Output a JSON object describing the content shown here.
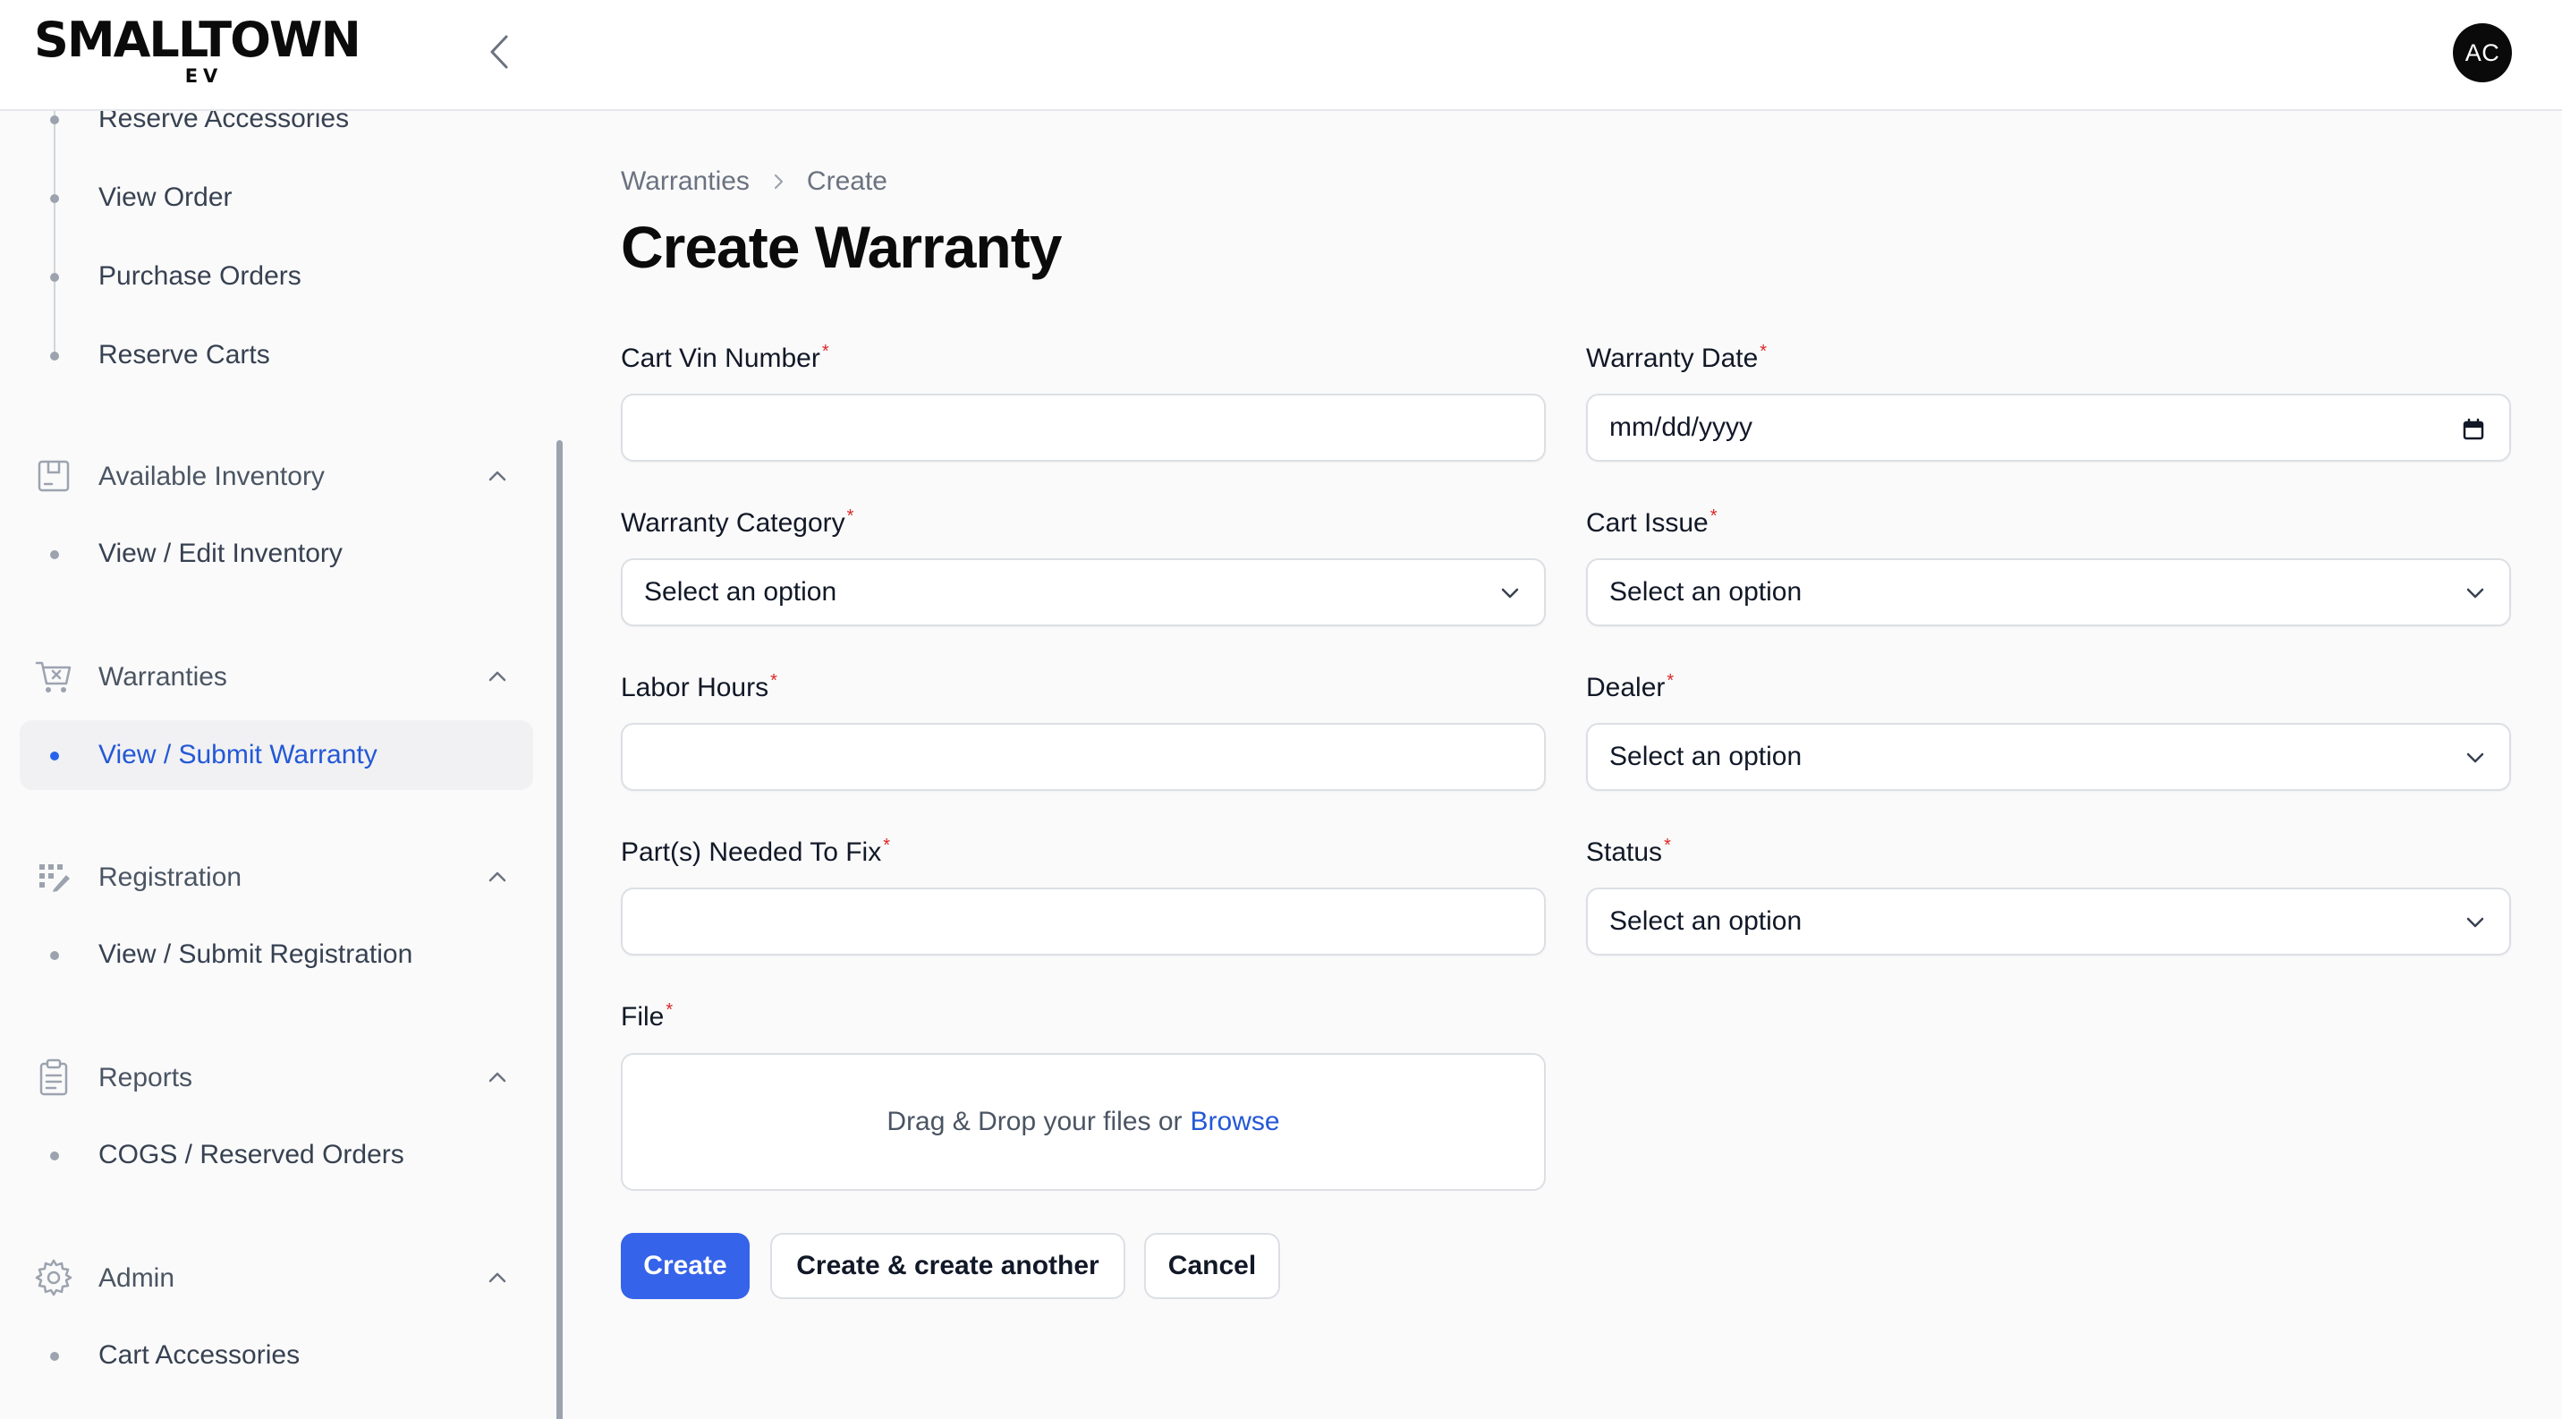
{
  "header": {
    "logo_main": "SMALLTOWN",
    "logo_sub": "EV",
    "avatar_initials": "AC"
  },
  "sidebar": {
    "top_items": [
      {
        "label": "Reserve Accessories"
      },
      {
        "label": "View Order"
      },
      {
        "label": "Purchase Orders"
      },
      {
        "label": "Reserve Carts"
      }
    ],
    "groups": [
      {
        "label": "Available Inventory",
        "icon": "inventory-icon",
        "items": [
          {
            "label": "View / Edit Inventory",
            "active": false
          }
        ]
      },
      {
        "label": "Warranties",
        "icon": "cart-x-icon",
        "items": [
          {
            "label": "View / Submit Warranty",
            "active": true
          }
        ]
      },
      {
        "label": "Registration",
        "icon": "registration-icon",
        "items": [
          {
            "label": "View / Submit Registration",
            "active": false
          }
        ]
      },
      {
        "label": "Reports",
        "icon": "clipboard-icon",
        "items": [
          {
            "label": "COGS / Reserved Orders",
            "active": false
          }
        ]
      },
      {
        "label": "Admin",
        "icon": "gear-icon",
        "items": [
          {
            "label": "Cart Accessories",
            "active": false
          }
        ]
      }
    ]
  },
  "breadcrumb": [
    "Warranties",
    "Create"
  ],
  "page_title": "Create Warranty",
  "form": {
    "cart_vin_number": {
      "label": "Cart Vin Number",
      "required": "*",
      "value": ""
    },
    "warranty_date": {
      "label": "Warranty Date",
      "required": "*",
      "placeholder": "mm/dd/yyyy"
    },
    "warranty_category": {
      "label": "Warranty Category",
      "required": "*",
      "selected": "Select an option"
    },
    "cart_issue": {
      "label": "Cart Issue",
      "required": "*",
      "selected": "Select an option"
    },
    "labor_hours": {
      "label": "Labor Hours",
      "required": "*",
      "value": ""
    },
    "dealer": {
      "label": "Dealer",
      "required": "*",
      "selected": "Select an option"
    },
    "parts_needed": {
      "label": "Part(s) Needed To Fix",
      "required": "*",
      "value": ""
    },
    "status": {
      "label": "Status",
      "required": "*",
      "selected": "Select an option"
    },
    "file": {
      "label": "File",
      "required": "*",
      "drop_text": "Drag & Drop your files or",
      "browse_label": "Browse"
    }
  },
  "actions": {
    "create": "Create",
    "create_another": "Create & create another",
    "cancel": "Cancel"
  },
  "colors": {
    "primary": "#3563e9",
    "active_link": "#2458d6",
    "required": "#dc2626"
  }
}
